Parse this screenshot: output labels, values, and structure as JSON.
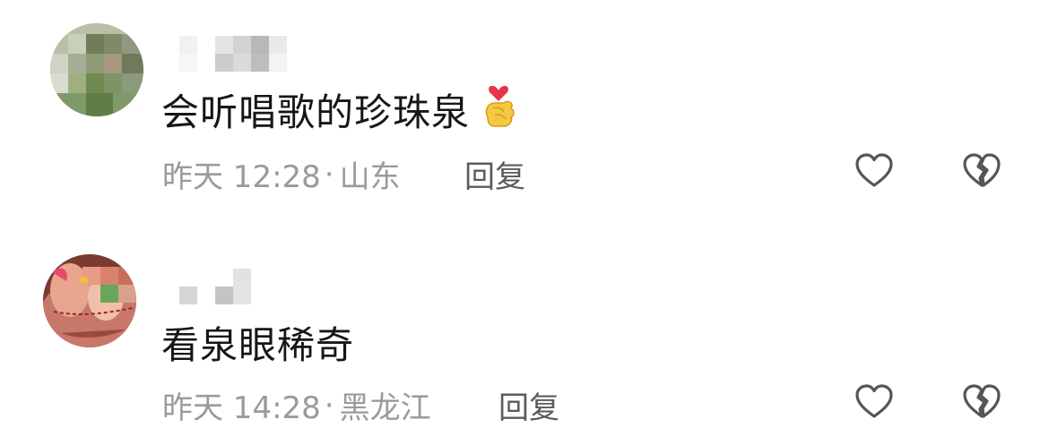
{
  "comments": [
    {
      "text": "会听唱歌的珍珠泉",
      "emoji": "finger-heart-emoji",
      "time": "昨天 12:28",
      "location": "山东",
      "reply_label": "回复",
      "like_icon": "heart-outline-icon",
      "dislike_icon": "broken-heart-icon"
    },
    {
      "text": "看泉眼稀奇",
      "time": "昨天 14:28",
      "location": "黑龙江",
      "reply_label": "回复",
      "like_icon": "heart-outline-icon",
      "dislike_icon": "broken-heart-icon"
    }
  ],
  "colors": {
    "text": "#161616",
    "meta": "#9a9a9a",
    "reply": "#5b5b5b",
    "icon": "#555555"
  }
}
